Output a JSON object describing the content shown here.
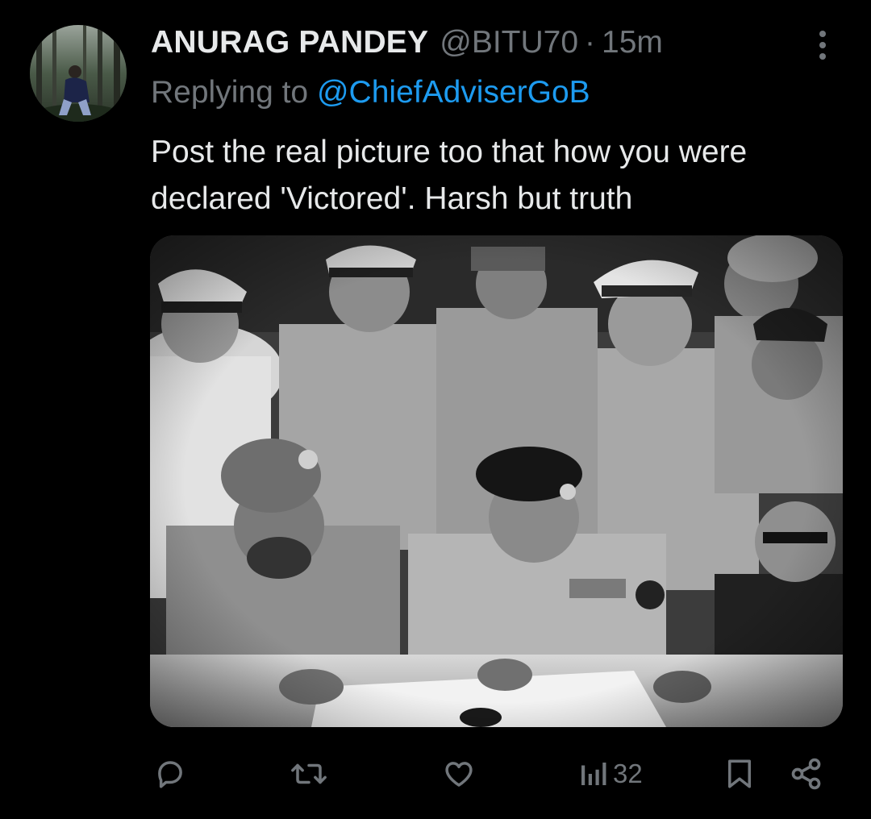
{
  "tweet": {
    "display_name": "ANURAG PANDEY",
    "handle": "@BITU70",
    "separator": "·",
    "time": "15m",
    "replying_prefix": "Replying to",
    "replying_to": "@ChiefAdviserGoB",
    "text": "Post the real picture too that how you were declared 'Victored'. Harsh but truth"
  },
  "actions": {
    "reply_icon": "reply-icon",
    "retweet_icon": "retweet-icon",
    "like_icon": "heart-icon",
    "views_icon": "views-bar-chart-icon",
    "views_count": "32",
    "bookmark_icon": "bookmark-icon",
    "share_icon": "share-icon"
  },
  "colors": {
    "background": "#000000",
    "text_primary": "#e7e9ea",
    "text_secondary": "#71767b",
    "link": "#1d9bf0"
  }
}
